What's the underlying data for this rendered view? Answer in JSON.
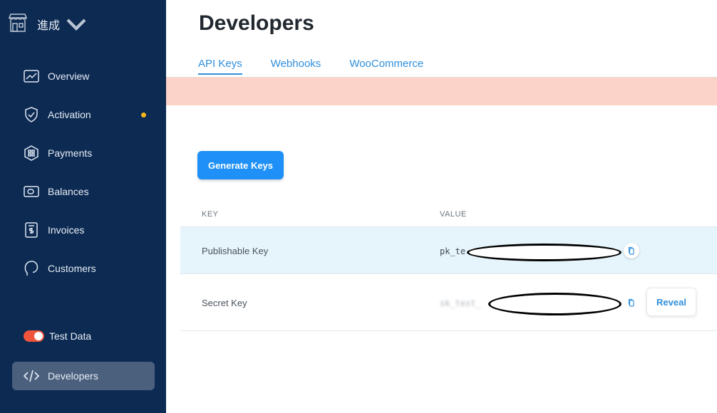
{
  "sidebar": {
    "store_name": "進成",
    "items": [
      {
        "label": "Overview"
      },
      {
        "label": "Activation"
      },
      {
        "label": "Payments"
      },
      {
        "label": "Balances"
      },
      {
        "label": "Invoices"
      },
      {
        "label": "Customers"
      }
    ],
    "test_data_label": "Test Data",
    "developers_label": "Developers"
  },
  "main": {
    "title": "Developers",
    "tabs": [
      {
        "label": "API Keys"
      },
      {
        "label": "Webhooks"
      },
      {
        "label": "WooCommerce"
      }
    ],
    "generate_button": "Generate Keys",
    "table": {
      "headers": [
        "KEY",
        "VALUE"
      ],
      "rows": [
        {
          "key": "Publishable Key",
          "value": "pk_te"
        },
        {
          "key": "Secret Key",
          "value": "sk_test_",
          "reveal": "Reveal"
        }
      ]
    }
  },
  "colors": {
    "sidebar_bg": "#0c2a52",
    "accent": "#1e90f7",
    "banner": "#fcd3c8",
    "toggle": "#f0553c",
    "notice_dot": "#f6b618"
  }
}
